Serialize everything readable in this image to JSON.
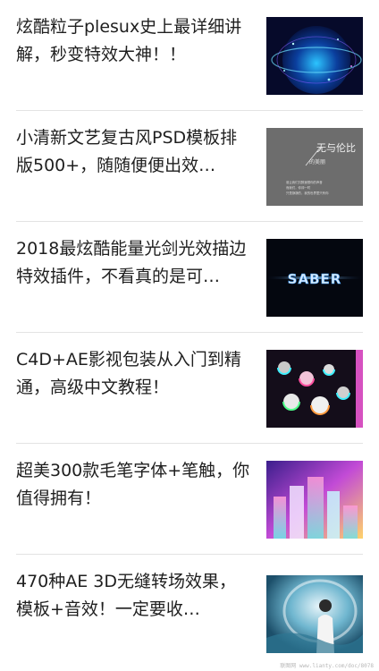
{
  "feed": {
    "items": [
      {
        "title": "炫酷粒子plesux史上最详细讲解，秒变特效大神！！",
        "thumb_icon": "globe-particles-thumbnail"
      },
      {
        "title": "小清新文艺复古风PSD模板排版500+，随随便便出效…",
        "thumb_icon": "retro-poster-thumbnail",
        "thumb_text": {
          "line1": "无与伦比",
          "line2": "的美丽",
          "small1": "谁让我们沉醉遥想你的声音",
          "small2": "而我们，你却一时",
          "small3": "只是静静的，我的世界里只有你"
        }
      },
      {
        "title": "2018最炫酷能量光剑光效描边特效插件，不看真的是可…",
        "thumb_icon": "saber-effect-thumbnail",
        "thumb_text": {
          "logo": "SABER"
        }
      },
      {
        "title": "C4D+AE影视包装从入门到精通，高级中文教程！",
        "thumb_icon": "glowing-spheres-thumbnail"
      },
      {
        "title": "超美300款毛笔字体+笔触，你值得拥有！",
        "thumb_icon": "gradient-blocks-thumbnail"
      },
      {
        "title": "470种AE 3D无缝转场效果，模板+音效！一定要收…",
        "thumb_icon": "portrait-transition-thumbnail"
      }
    ]
  },
  "watermark": "联图网 www.lianty.com/doc/8078",
  "colors": {
    "text": "#1f1f1f",
    "divider": "#e3e3e3"
  }
}
